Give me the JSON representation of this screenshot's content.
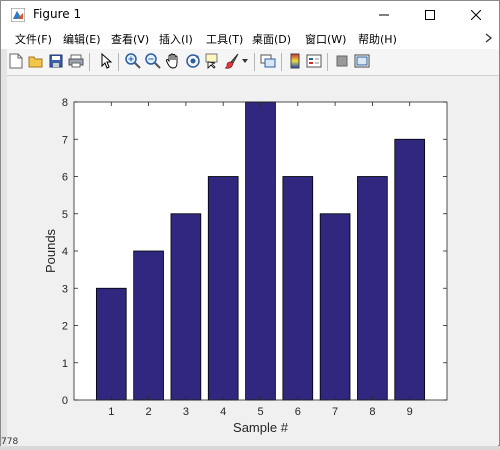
{
  "window": {
    "title": "Figure 1"
  },
  "menu": [
    {
      "label": "文件(F)"
    },
    {
      "label": "编辑(E)"
    },
    {
      "label": "查看(V)"
    },
    {
      "label": "插入(I)"
    },
    {
      "label": "工具(T)"
    },
    {
      "label": "桌面(D)"
    },
    {
      "label": "窗口(W)"
    },
    {
      "label": "帮助(H)"
    }
  ],
  "menu_overflow_icon": "arrow-right-icon",
  "toolbar": [
    "new-figure-icon",
    "open-file-icon",
    "save-icon",
    "print-icon",
    "edit-plot-arrow-icon",
    "zoom-in-icon",
    "zoom-out-icon",
    "pan-hand-icon",
    "rotate-3d-icon",
    "data-cursor-icon",
    "brush-icon",
    "brush-dropdown-icon",
    "link-plot-icon",
    "insert-colorbar-icon",
    "insert-legend-icon",
    "hide-plot-tools-icon",
    "show-plot-tools-icon"
  ],
  "chart_data": {
    "type": "bar",
    "categories": [
      "1",
      "2",
      "3",
      "4",
      "5",
      "6",
      "7",
      "8",
      "9"
    ],
    "values": [
      3,
      4,
      5,
      6,
      8,
      6,
      5,
      6,
      7
    ],
    "title": "",
    "xlabel": "Sample #",
    "ylabel": "Pounds",
    "ylim": [
      0,
      8
    ],
    "yticks": [
      "0",
      "1",
      "2",
      "3",
      "4",
      "5",
      "6",
      "7",
      "8"
    ],
    "bar_color": "#30287e",
    "bar_edge_color": "#000000",
    "grid": false
  },
  "background_text": {
    "edge_number": "778"
  }
}
